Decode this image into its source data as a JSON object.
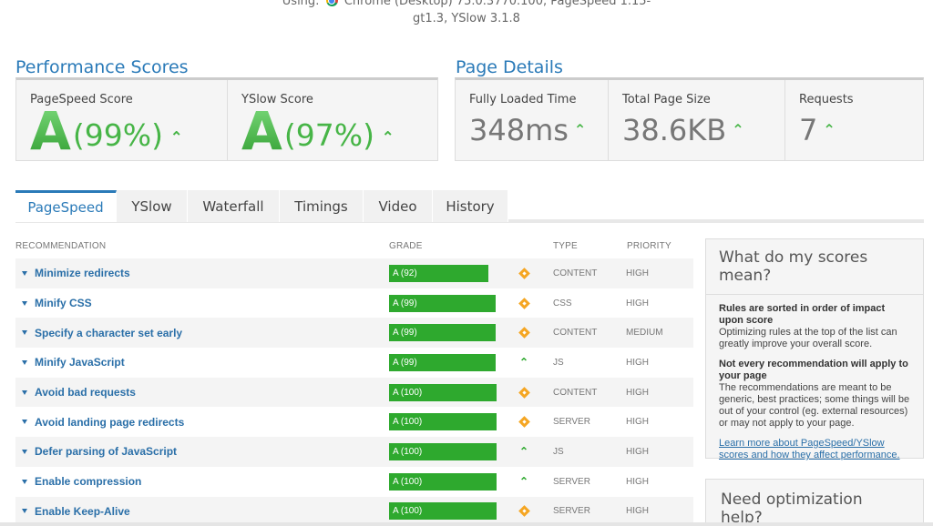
{
  "header": {
    "using_label": "Using:",
    "browser_line1": "Chrome (Desktop) 75.0.3770.100, PageSpeed 1.15-",
    "browser_line2": "gt1.3, YSlow 3.1.8"
  },
  "performance": {
    "title": "Performance Scores",
    "pagespeed": {
      "label": "PageSpeed Score",
      "grade": "A",
      "percent": "(99%)"
    },
    "yslow": {
      "label": "YSlow Score",
      "grade": "A",
      "percent": "(97%)"
    }
  },
  "details": {
    "title": "Page Details",
    "fully_loaded": {
      "label": "Fully Loaded Time",
      "value": "348ms"
    },
    "page_size": {
      "label": "Total Page Size",
      "value": "38.6KB"
    },
    "requests": {
      "label": "Requests",
      "value": "7"
    }
  },
  "tabs": [
    {
      "label": "PageSpeed"
    },
    {
      "label": "YSlow"
    },
    {
      "label": "Waterfall"
    },
    {
      "label": "Timings"
    },
    {
      "label": "Video"
    },
    {
      "label": "History"
    }
  ],
  "columns": {
    "recommendation": "RECOMMENDATION",
    "grade": "GRADE",
    "type": "TYPE",
    "priority": "PRIORITY"
  },
  "recommendations": [
    {
      "name": "Minimize redirects",
      "grade": "A (92)",
      "score": 92,
      "trend": "neutral",
      "type": "CONTENT",
      "priority": "HIGH"
    },
    {
      "name": "Minify CSS",
      "grade": "A (99)",
      "score": 99,
      "trend": "neutral",
      "type": "CSS",
      "priority": "HIGH"
    },
    {
      "name": "Specify a character set early",
      "grade": "A (99)",
      "score": 99,
      "trend": "neutral",
      "type": "CONTENT",
      "priority": "MEDIUM"
    },
    {
      "name": "Minify JavaScript",
      "grade": "A (99)",
      "score": 99,
      "trend": "up",
      "type": "JS",
      "priority": "HIGH"
    },
    {
      "name": "Avoid bad requests",
      "grade": "A (100)",
      "score": 100,
      "trend": "neutral",
      "type": "CONTENT",
      "priority": "HIGH"
    },
    {
      "name": "Avoid landing page redirects",
      "grade": "A (100)",
      "score": 100,
      "trend": "neutral",
      "type": "SERVER",
      "priority": "HIGH"
    },
    {
      "name": "Defer parsing of JavaScript",
      "grade": "A (100)",
      "score": 100,
      "trend": "up",
      "type": "JS",
      "priority": "HIGH"
    },
    {
      "name": "Enable compression",
      "grade": "A (100)",
      "score": 100,
      "trend": "up",
      "type": "SERVER",
      "priority": "HIGH"
    },
    {
      "name": "Enable Keep-Alive",
      "grade": "A (100)",
      "score": 100,
      "trend": "neutral",
      "type": "SERVER",
      "priority": "HIGH"
    }
  ],
  "scores_panel": {
    "title": "What do my scores mean?",
    "heading1": "Rules are sorted in order of impact upon score",
    "text1": "Optimizing rules at the top of the list can greatly improve your overall score.",
    "heading2": "Not every recommendation will apply to your page",
    "text2": "The recommendations are meant to be generic, best practices; some things will be out of your control (eg. external resources) or may not apply to your page.",
    "link": "Learn more about PageSpeed/YSlow scores and how they affect performance."
  },
  "help_panel": {
    "title": "Need optimization help?"
  },
  "colors": {
    "accent": "#2a7ab8",
    "grade_green": "#2ea92e",
    "neutral_orange": "#f5a623"
  },
  "icons": {
    "up": "chevron-up-icon",
    "neutral": "diamond-icon",
    "caret": "caret-down-icon",
    "browser": "chrome-icon"
  }
}
